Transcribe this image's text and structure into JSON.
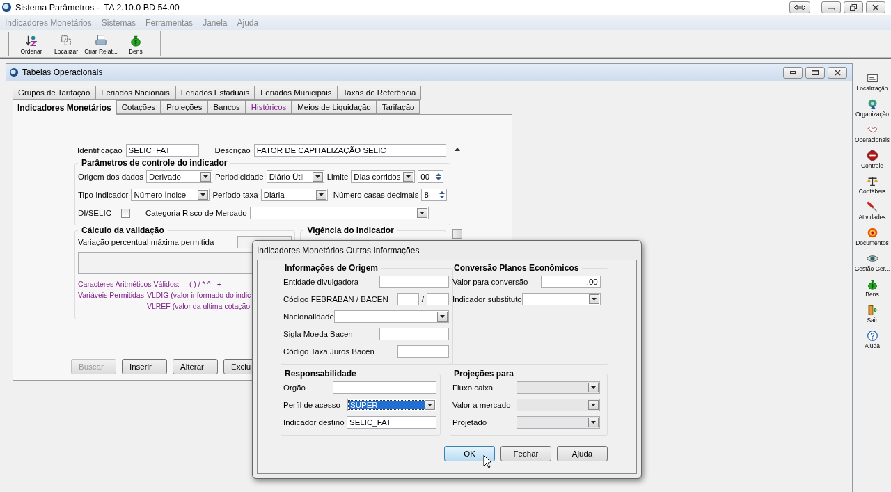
{
  "window": {
    "title": "Sistema Parâmetros -  TA 2.10.0 BD 54.00"
  },
  "menu": [
    "Indicadores Monetários",
    "Sistemas",
    "Ferramentas",
    "Janela",
    "Ajuda"
  ],
  "toolbar": [
    {
      "label": "Ordenar",
      "kind": "sort"
    },
    {
      "label": "Localizar",
      "kind": "select"
    },
    {
      "label": "Criar Relat...",
      "kind": "print"
    },
    {
      "label": "Bens",
      "kind": "bag"
    }
  ],
  "child_window": {
    "title": "Tabelas Operacionais",
    "tab_rows": [
      [
        {
          "label": "Grupos de Tarifação",
          "selected": false,
          "highlighted": false
        },
        {
          "label": "Feriados Nacionais",
          "selected": false,
          "highlighted": false
        },
        {
          "label": "Feriados Estaduais",
          "selected": false,
          "highlighted": false
        },
        {
          "label": "Feriados Municipais",
          "selected": false,
          "highlighted": false
        },
        {
          "label": "Taxas de Referência",
          "selected": false,
          "highlighted": false
        }
      ],
      [
        {
          "label": "Indicadores Monetários",
          "selected": true,
          "highlighted": false
        },
        {
          "label": "Cotações",
          "selected": false,
          "highlighted": false
        },
        {
          "label": "Projeções",
          "selected": false,
          "highlighted": false
        },
        {
          "label": "Bancos",
          "selected": false,
          "highlighted": false
        },
        {
          "label": "Históricos",
          "selected": false,
          "highlighted": true
        },
        {
          "label": "Meios de Liquidação",
          "selected": false,
          "highlighted": false
        },
        {
          "label": "Tarifação",
          "selected": false,
          "highlighted": false
        }
      ]
    ],
    "identificacao": {
      "label": "Identificação",
      "value": "SELIC_FAT"
    },
    "descricao": {
      "label": "Descrição",
      "value": "FATOR DE CAPITALIZAÇÃO SELIC"
    },
    "parametros": {
      "title": "Parâmetros de controle do indicador",
      "rows": [
        {
          "fields": [
            {
              "kind": "label",
              "text": "Origem dos dados"
            },
            {
              "kind": "combo",
              "value": "Derivado"
            },
            {
              "kind": "label",
              "text": "Periodicidade"
            },
            {
              "kind": "combo",
              "value": "Diário Útil"
            },
            {
              "kind": "label",
              "text": "Limite"
            },
            {
              "kind": "combo",
              "value": "Dias corridos"
            },
            {
              "kind": "spin",
              "value": "00"
            }
          ]
        },
        {
          "fields": [
            {
              "kind": "label",
              "text": "Tipo Indicador"
            },
            {
              "kind": "combo",
              "value": "Número Índice"
            },
            {
              "kind": "label",
              "text": "Período taxa"
            },
            {
              "kind": "combo",
              "value": "Diária"
            },
            {
              "kind": "label",
              "text": "Número casas decimais"
            },
            {
              "kind": "spin",
              "value": "8"
            }
          ]
        },
        {
          "fields": [
            {
              "kind": "label",
              "text": "DI/SELIC"
            },
            {
              "kind": "checkbox",
              "checked": false
            },
            {
              "kind": "label",
              "text": "Categoria Risco de Mercado"
            },
            {
              "kind": "combo"
            }
          ]
        }
      ]
    },
    "calculo": {
      "title": "Cálculo da validação",
      "label": "Variação percentual máxima permitida",
      "notes": [
        {
          "label": "Caracteres Aritméticos Válidos:",
          "lines": [
            "( ) / * ^ - +"
          ]
        },
        {
          "label": "Variáveis Permitidas",
          "lines": [
            "VLDIG  (valor informado do indic",
            "VLREF (valor da ultima cotação"
          ]
        }
      ]
    },
    "vigencia": {
      "title": "Vigência do indicador"
    },
    "buttons": [
      {
        "label": "Buscar",
        "disabled": true
      },
      {
        "label": "Inserir",
        "disabled": false
      },
      {
        "label": "Alterar",
        "disabled": false
      },
      {
        "label": "Exclu",
        "disabled": false
      }
    ]
  },
  "sidebar": [
    {
      "label": "Localização",
      "kind": "card"
    },
    {
      "label": "Organização",
      "kind": "org"
    },
    {
      "label": "Operacionais",
      "kind": "handshake"
    },
    {
      "label": "Controle",
      "kind": "stop"
    },
    {
      "label": "Contábeis",
      "kind": "scales"
    },
    {
      "label": "Atividades",
      "kind": "tool"
    },
    {
      "label": "Documentos",
      "kind": "target"
    },
    {
      "label": "Gestão Ger...",
      "kind": "eye"
    },
    {
      "label": "Bens",
      "kind": "bag"
    },
    {
      "label": "Sair",
      "kind": "door"
    },
    {
      "label": "Ajuda",
      "kind": "help"
    }
  ],
  "dialog": {
    "title": "Indicadores Monetários Outras Informações",
    "groups": [
      {
        "title": "Informações de Origem",
        "fields": [
          {
            "label": "Entidade divulgadora",
            "kind": "text",
            "focused": false,
            "disabled": false
          },
          {
            "label": "Código FEBRABAN / BACEN",
            "kind": "pair",
            "separator": "/",
            "focused": false,
            "disabled": false
          },
          {
            "label": "Nacionalidade",
            "kind": "combo",
            "focused": false,
            "disabled": false
          },
          {
            "label": "Sigla Moeda Bacen",
            "kind": "text",
            "focused": false,
            "disabled": false
          },
          {
            "label": "Código Taxa Juros Bacen",
            "kind": "text",
            "focused": false,
            "disabled": false
          }
        ]
      },
      {
        "title": "Conversão Planos Econômicos",
        "fields": [
          {
            "label": "Valor para conversão",
            "kind": "number",
            "value": ",00",
            "focused": false,
            "disabled": false
          },
          {
            "label": "Indicador substituto",
            "kind": "combo",
            "focused": false,
            "disabled": false
          }
        ]
      },
      {
        "title": "Responsabilidade",
        "fields": [
          {
            "label": "Orgão",
            "kind": "text",
            "focused": false,
            "disabled": false
          },
          {
            "label": "Perfil de acesso",
            "kind": "combo",
            "value": "SUPER",
            "focused": true,
            "disabled": false
          },
          {
            "label": "Indicador destino",
            "kind": "text",
            "value": "SELIC_FAT",
            "focused": false,
            "disabled": false
          }
        ]
      },
      {
        "title": "Projeções para",
        "fields": [
          {
            "label": "Fluxo caixa",
            "kind": "combo",
            "focused": false,
            "disabled": true
          },
          {
            "label": "Valor a mercado",
            "kind": "combo",
            "focused": false,
            "disabled": true
          },
          {
            "label": "Projetado",
            "kind": "combo",
            "focused": false,
            "disabled": true
          }
        ]
      }
    ],
    "buttons": [
      {
        "label": "OK",
        "default": true
      },
      {
        "label": "Fechar",
        "default": false
      },
      {
        "label": "Ajuda",
        "default": false
      }
    ]
  }
}
